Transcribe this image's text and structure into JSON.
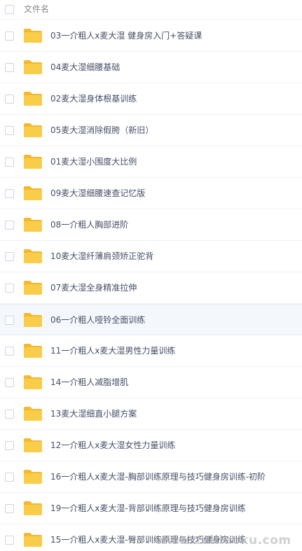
{
  "header": {
    "column_label": "文件名"
  },
  "folders": [
    "03一介粗人x麦大湿 健身房入门+答疑课",
    "04麦大湿细腰基础",
    "02麦大湿身体根基训练",
    "05麦大湿消除假胯（新旧）",
    "01麦大湿小围度大比例",
    "09麦大湿细腰速查记忆版",
    "08一介粗人胸部进阶",
    "10麦大湿纤薄肩颈矫正驼背",
    "07麦大湿全身精准拉伸",
    "06一介粗人哑铃全面训练",
    "11一介粗人x麦大湿男性力量训练",
    "14一介粗人减脂增肌",
    "13麦大湿细直小腿方案",
    "12一介粗人x麦大湿女性力量训练",
    "16一介粗人x麦大湿-胸部训练原理与技巧健身房训练-初阶",
    "19一介粗人x麦大湿-背部训练原理与技巧健身房训练",
    "15一介粗人x麦大湿-臀部训练原理与技巧健身房训练"
  ],
  "highlighted_index": 9,
  "watermark": "www.zuliluoku.com",
  "colors": {
    "folder": "#f9cc49",
    "folder_tab": "#f5b82e",
    "highlight": "#f4f8fd"
  }
}
